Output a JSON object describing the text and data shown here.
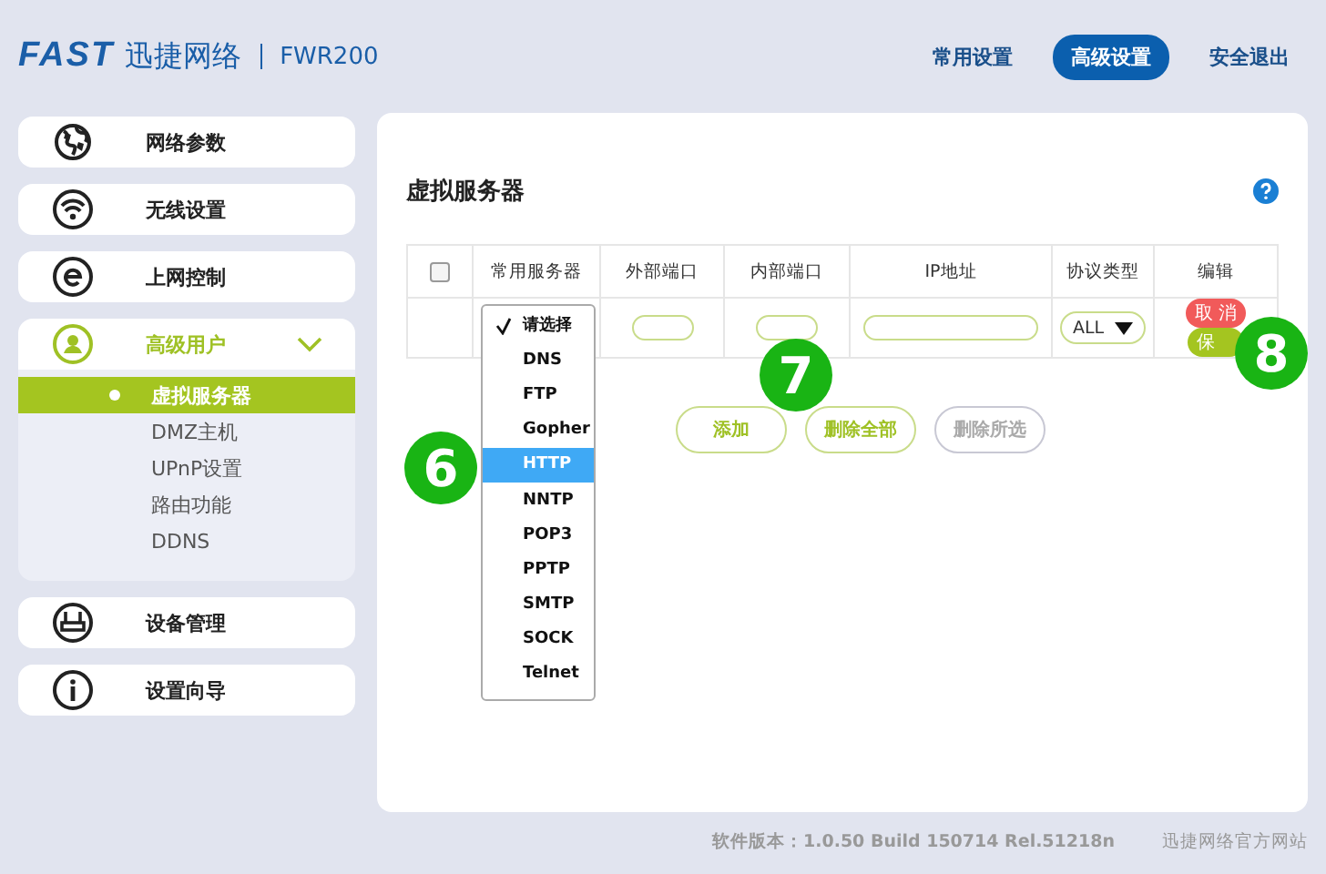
{
  "header": {
    "logo": "FAST",
    "brand": "迅捷网络",
    "model": "FWR200",
    "nav": [
      {
        "label": "常用设置",
        "selected": false
      },
      {
        "label": "高级设置",
        "selected": true
      },
      {
        "label": "安全退出",
        "selected": false
      }
    ]
  },
  "sidebar": {
    "items": [
      {
        "label": "网络参数",
        "expanded": false
      },
      {
        "label": "无线设置",
        "expanded": false
      },
      {
        "label": "上网控制",
        "expanded": false
      },
      {
        "label": "高级用户",
        "expanded": true,
        "children": [
          {
            "label": "虚拟服务器",
            "selected": true
          },
          {
            "label": "DMZ主机",
            "selected": false
          },
          {
            "label": "UPnP设置",
            "selected": false
          },
          {
            "label": "路由功能",
            "selected": false
          },
          {
            "label": "DDNS",
            "selected": false
          }
        ]
      },
      {
        "label": "设备管理",
        "expanded": false
      },
      {
        "label": "设置向导",
        "expanded": false
      }
    ]
  },
  "main": {
    "title": "虚拟服务器",
    "table": {
      "select_all": {
        "checked": false
      },
      "columns": [
        "常用服务器",
        "外部端口",
        "内部端口",
        "IP地址",
        "协议类型",
        "编辑"
      ],
      "row": {
        "protocol": "ALL",
        "cancel": "取 消",
        "save": "保"
      }
    },
    "dropdown": [
      {
        "label": "请选择",
        "checked": true,
        "selected": false
      },
      {
        "label": "DNS",
        "checked": false,
        "selected": false
      },
      {
        "label": "FTP",
        "checked": false,
        "selected": false
      },
      {
        "label": "Gopher",
        "checked": false,
        "selected": false
      },
      {
        "label": "HTTP",
        "checked": false,
        "selected": true
      },
      {
        "label": "NNTP",
        "checked": false,
        "selected": false
      },
      {
        "label": "POP3",
        "checked": false,
        "selected": false
      },
      {
        "label": "PPTP",
        "checked": false,
        "selected": false
      },
      {
        "label": "SMTP",
        "checked": false,
        "selected": false
      },
      {
        "label": "SOCK",
        "checked": false,
        "selected": false
      },
      {
        "label": "Telnet",
        "checked": false,
        "selected": false
      }
    ],
    "buttons": [
      {
        "label": "添加",
        "disabled": false
      },
      {
        "label": "删除全部",
        "disabled": false
      },
      {
        "label": "删除所选",
        "disabled": true
      }
    ],
    "annotations": [
      {
        "label": "6"
      },
      {
        "label": "7"
      },
      {
        "label": "8"
      }
    ]
  },
  "footer": {
    "version": "软件版本：1.0.50 Build 150714 Rel.51218n",
    "link": "迅捷网络官方网站"
  }
}
